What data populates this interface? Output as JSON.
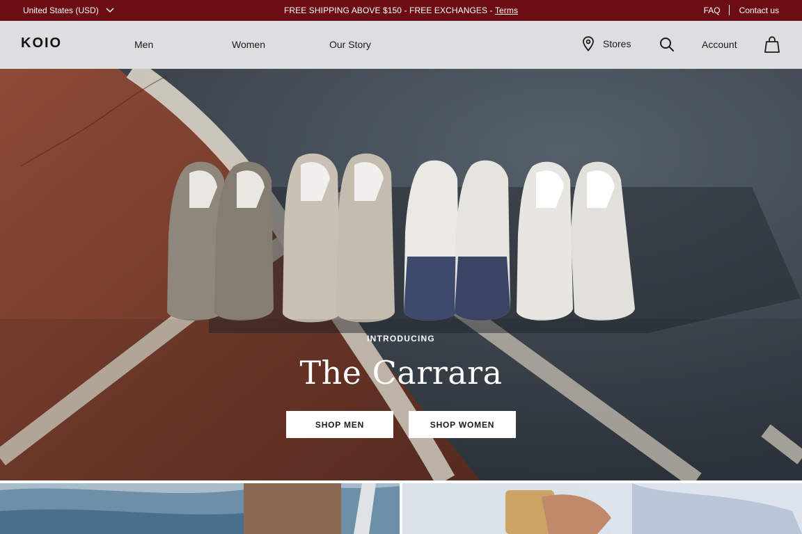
{
  "topbar": {
    "currency": "United States (USD)",
    "promo_text": "FREE SHIPPING ABOVE $150 - FREE EXCHANGES - ",
    "promo_link": "Terms",
    "faq": "FAQ",
    "contact": "Contact us"
  },
  "header": {
    "logo": "KOIO",
    "nav": [
      "Men",
      "Women",
      "Our Story"
    ],
    "stores": "Stores",
    "account": "Account"
  },
  "hero": {
    "eyebrow": "INTRODUCING",
    "title": "The Carrara",
    "cta_men": "SHOP MEN",
    "cta_women": "SHOP WOMEN"
  },
  "icons": [
    "chevron-down-icon",
    "map-pin-icon",
    "search-icon",
    "shopping-bag-icon"
  ],
  "colors": {
    "topbar_bg": "#6b0d13",
    "header_bg": "#dcdedf",
    "court_red": "#8a4532",
    "court_slate": "#414b55",
    "button_bg": "#ffffff"
  }
}
